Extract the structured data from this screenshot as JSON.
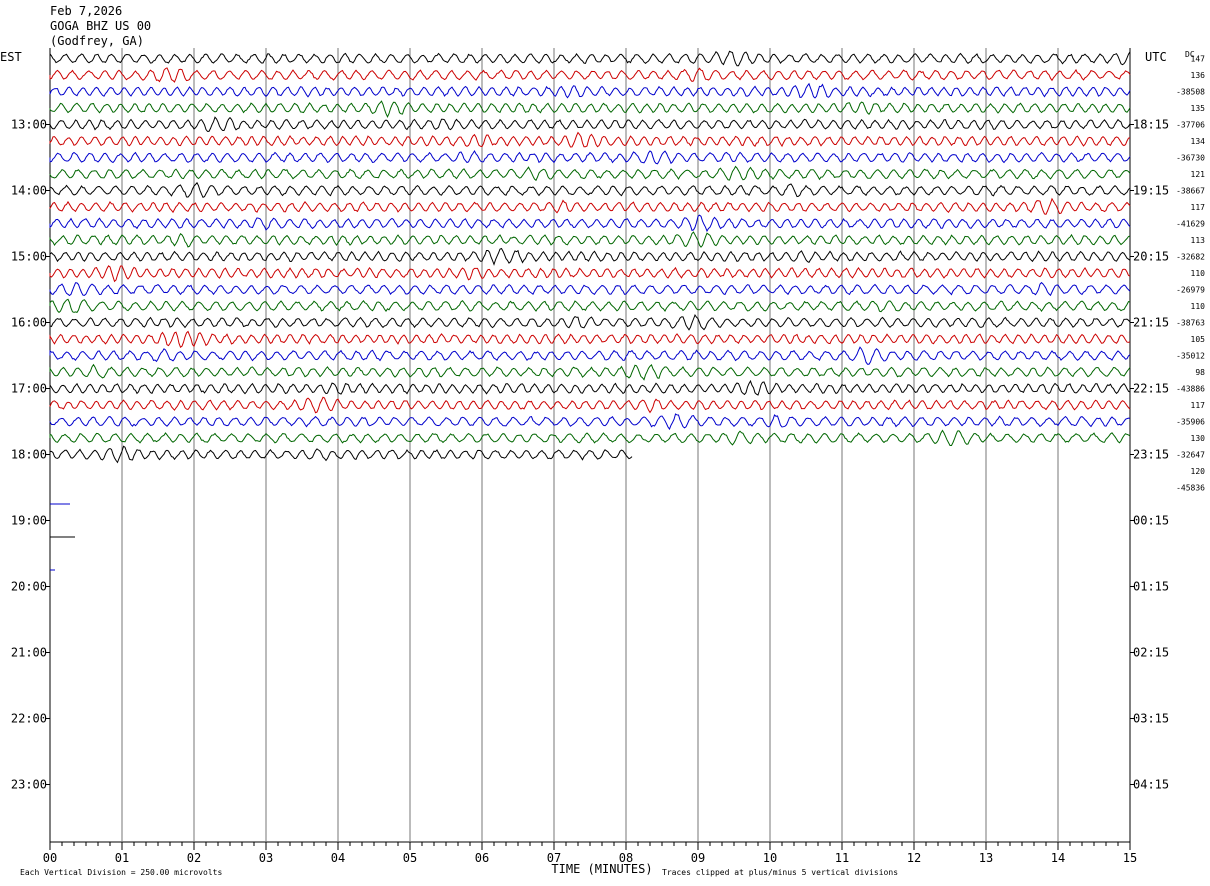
{
  "header": {
    "date": "Feb 7,2026",
    "station": "GOGA BHZ US 00",
    "location": "(Godfrey, GA)"
  },
  "chart_data": {
    "type": "line",
    "title": "Feb 7,2026 GOGA BHZ US 00 (Godfrey, GA)",
    "left_timezone": "EST",
    "right_timezone": "UTC",
    "dc_label": "DC",
    "xlabel": "TIME (MINUTES)",
    "x_ticks": [
      "00",
      "01",
      "02",
      "03",
      "04",
      "05",
      "06",
      "07",
      "08",
      "09",
      "10",
      "11",
      "12",
      "13",
      "14",
      "15"
    ],
    "xlim": [
      0,
      15
    ],
    "minutes_per_trace": 15,
    "left_hour_labels": [
      "13:00",
      "14:00",
      "15:00",
      "16:00",
      "17:00",
      "18:00",
      "19:00",
      "20:00",
      "21:00",
      "22:00",
      "23:00"
    ],
    "right_hour_labels": [
      "18:15",
      "19:15",
      "20:15",
      "21:15",
      "22:15",
      "23:15",
      "00:15",
      "01:15",
      "02:15",
      "03:15",
      "04:15"
    ],
    "trace_colors": [
      "#000000",
      "#cc0000",
      "#0000cc",
      "#006600"
    ],
    "total_trace_rows": 24,
    "dc_offsets": [
      "147",
      "136",
      "-38508",
      "135",
      "-37706",
      "134",
      "-36730",
      "121",
      "-38667",
      "117",
      "-41629",
      "113",
      "-32682",
      "110",
      "-26979",
      "110",
      "-38763",
      "105",
      "-35012",
      "98",
      "-43886",
      "117",
      "-35906",
      "130",
      "-32647",
      "120",
      "-45836"
    ],
    "last_trace_end_minute": 8.1,
    "note_scale": "Each Vertical Division =  250.00 microvolts",
    "note_clip": "Traces clipped at plus/minus 5 vertical divisions"
  }
}
